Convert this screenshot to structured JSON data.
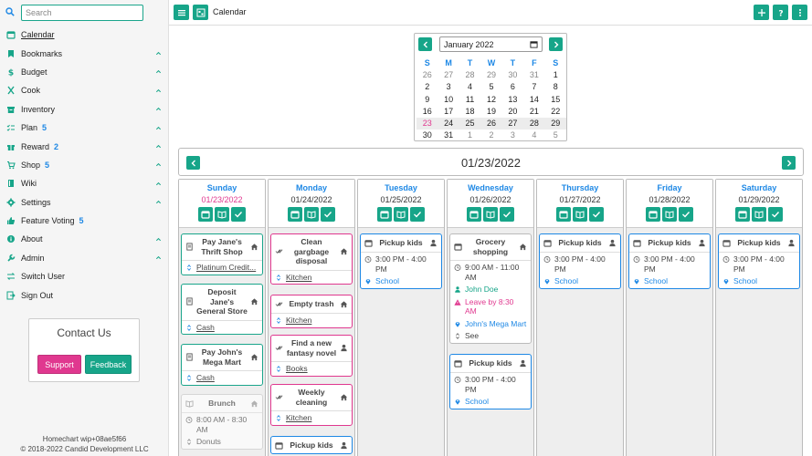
{
  "search": {
    "placeholder": "Search"
  },
  "nav": [
    {
      "label": "Calendar",
      "icon": "calendar-icon",
      "active": true
    },
    {
      "label": "Bookmarks",
      "icon": "bookmark-icon",
      "chevron": true
    },
    {
      "label": "Budget",
      "icon": "dollar-icon",
      "chevron": true
    },
    {
      "label": "Cook",
      "icon": "utensils-icon",
      "chevron": true
    },
    {
      "label": "Inventory",
      "icon": "archive-icon",
      "chevron": true
    },
    {
      "label": "Plan",
      "icon": "checklist-icon",
      "count": "5",
      "chevron": true
    },
    {
      "label": "Reward",
      "icon": "gift-icon",
      "count": "2",
      "chevron": true
    },
    {
      "label": "Shop",
      "icon": "cart-icon",
      "count": "5",
      "chevron": true
    },
    {
      "label": "Wiki",
      "icon": "book-icon",
      "chevron": true
    },
    {
      "label": "Settings",
      "icon": "gear-icon",
      "chevron": true
    },
    {
      "label": "Feature Voting",
      "icon": "thumbs-up-icon",
      "count": "5"
    },
    {
      "label": "About",
      "icon": "info-icon",
      "chevron": true
    },
    {
      "label": "Admin",
      "icon": "wrench-icon",
      "chevron": true
    },
    {
      "label": "Switch User",
      "icon": "switch-user-icon"
    },
    {
      "label": "Sign Out",
      "icon": "sign-out-icon"
    }
  ],
  "contact": {
    "title": "Contact Us",
    "support": "Support",
    "feedback": "Feedback"
  },
  "footer": {
    "version": "Homechart wip+08ae5f66",
    "copyright": "© 2018-2022 Candid Development LLC"
  },
  "header": {
    "title": "Calendar"
  },
  "minical": {
    "month": "January 2022",
    "weekdays": [
      "S",
      "M",
      "T",
      "W",
      "T",
      "F",
      "S"
    ],
    "weeks": [
      [
        "26",
        "27",
        "28",
        "29",
        "30",
        "31",
        "1"
      ],
      [
        "2",
        "3",
        "4",
        "5",
        "6",
        "7",
        "8"
      ],
      [
        "9",
        "10",
        "11",
        "12",
        "13",
        "14",
        "15"
      ],
      [
        "16",
        "17",
        "18",
        "19",
        "20",
        "21",
        "22"
      ],
      [
        "23",
        "24",
        "25",
        "26",
        "27",
        "28",
        "29"
      ],
      [
        "30",
        "31",
        "1",
        "2",
        "3",
        "4",
        "5"
      ]
    ]
  },
  "week": {
    "date": "01/23/2022",
    "days": [
      {
        "name": "Sunday",
        "date": "01/23/2022",
        "today": true,
        "events": [
          {
            "color": "green",
            "icon": "receipt-icon",
            "right": "home-icon",
            "title": "Pay Jane's Thrift Shop",
            "rows": [
              {
                "icon": "swap-icon",
                "text": "Platinum Credit...",
                "style": "link"
              }
            ]
          },
          {
            "color": "green",
            "icon": "receipt-icon",
            "right": "home-icon",
            "title": "Deposit Jane's General Store",
            "rows": [
              {
                "icon": "swap-icon",
                "text": "Cash",
                "style": "link"
              }
            ]
          },
          {
            "color": "green",
            "icon": "receipt-icon",
            "right": "home-icon",
            "title": "Pay John's Mega Mart",
            "rows": [
              {
                "icon": "swap-icon",
                "text": "Cash",
                "style": "link"
              }
            ]
          },
          {
            "color": "grey",
            "icon": "menu-book-icon",
            "right": "home-icon",
            "title": "Brunch",
            "rows": [
              {
                "icon": "clock-icon",
                "text": "8:00 AM - 8:30 AM"
              },
              {
                "icon": "swap-icon",
                "text": "Donuts"
              }
            ]
          }
        ]
      },
      {
        "name": "Monday",
        "date": "01/24/2022",
        "events": [
          {
            "color": "pink",
            "icon": "check-icon",
            "right": "home-icon",
            "title": "Clean gargbage disposal",
            "rows": [
              {
                "icon": "swap-icon",
                "text": "Kitchen",
                "style": "link"
              }
            ]
          },
          {
            "color": "pink",
            "icon": "check-icon",
            "right": "home-icon",
            "title": "Empty trash",
            "rows": [
              {
                "icon": "swap-icon",
                "text": "Kitchen",
                "style": "link"
              }
            ]
          },
          {
            "color": "pink",
            "icon": "check-icon",
            "right": "person-icon",
            "title": "Find a new fantasy novel",
            "rows": [
              {
                "icon": "swap-icon",
                "text": "Books",
                "style": "link"
              }
            ]
          },
          {
            "color": "pink",
            "icon": "check-icon",
            "right": "home-icon",
            "title": "Weekly cleaning",
            "rows": [
              {
                "icon": "swap-icon",
                "text": "Kitchen",
                "style": "link"
              }
            ]
          },
          {
            "color": "blue",
            "icon": "calendar-icon",
            "right": "person-icon",
            "title": "Pickup kids",
            "rows": []
          }
        ]
      },
      {
        "name": "Tuesday",
        "date": "01/25/2022",
        "events": [
          {
            "color": "blue",
            "icon": "calendar-icon",
            "right": "person-icon",
            "title": "Pickup kids",
            "rows": [
              {
                "icon": "clock-icon",
                "text": "3:00 PM - 4:00 PM"
              },
              {
                "icon": "pin-icon",
                "text": "School",
                "style": "blue"
              }
            ]
          }
        ]
      },
      {
        "name": "Wednesday",
        "date": "01/26/2022",
        "events": [
          {
            "color": "grey2",
            "icon": "calendar-icon",
            "right": "home-icon",
            "title": "Grocery shopping",
            "rows": [
              {
                "icon": "clock-icon",
                "text": "9:00 AM - 11:00 AM"
              },
              {
                "icon": "person-icon",
                "text": "John Doe",
                "style": "green"
              },
              {
                "icon": "warning-icon",
                "text": "Leave by 8:30 AM",
                "style": "pink"
              },
              {
                "icon": "pin-icon",
                "text": "John's Mega Mart",
                "style": "blue"
              },
              {
                "icon": "swap-icon",
                "text": "See"
              }
            ]
          },
          {
            "color": "blue",
            "icon": "calendar-icon",
            "right": "person-icon",
            "title": "Pickup kids",
            "rows": [
              {
                "icon": "clock-icon",
                "text": "3:00 PM - 4:00 PM"
              },
              {
                "icon": "pin-icon",
                "text": "School",
                "style": "blue"
              }
            ]
          }
        ]
      },
      {
        "name": "Thursday",
        "date": "01/27/2022",
        "events": [
          {
            "color": "blue",
            "icon": "calendar-icon",
            "right": "person-icon",
            "title": "Pickup kids",
            "rows": [
              {
                "icon": "clock-icon",
                "text": "3:00 PM - 4:00 PM"
              },
              {
                "icon": "pin-icon",
                "text": "School",
                "style": "blue"
              }
            ]
          }
        ]
      },
      {
        "name": "Friday",
        "date": "01/28/2022",
        "events": [
          {
            "color": "blue",
            "icon": "calendar-icon",
            "right": "person-icon",
            "title": "Pickup kids",
            "rows": [
              {
                "icon": "clock-icon",
                "text": "3:00 PM - 4:00 PM"
              },
              {
                "icon": "pin-icon",
                "text": "School",
                "style": "blue"
              }
            ]
          }
        ]
      },
      {
        "name": "Saturday",
        "date": "01/29/2022",
        "events": [
          {
            "color": "blue",
            "icon": "calendar-icon",
            "right": "person-icon",
            "title": "Pickup kids",
            "rows": [
              {
                "icon": "clock-icon",
                "text": "3:00 PM - 4:00 PM"
              },
              {
                "icon": "pin-icon",
                "text": "School",
                "style": "blue"
              }
            ]
          }
        ]
      }
    ]
  },
  "colors": {
    "accent": "#17a589",
    "pink": "#e0388f",
    "blue": "#1e88e5"
  }
}
